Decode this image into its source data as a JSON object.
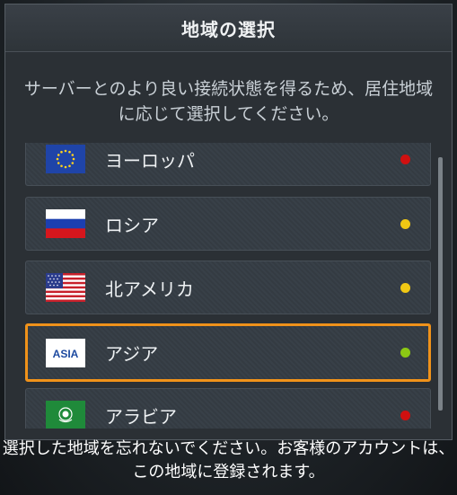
{
  "dialog": {
    "title": "地域の選択",
    "description": "サーバーとのより良い接続状態を得るため、居住地域に応じて選択してください。"
  },
  "regions": [
    {
      "label": "ヨーロッパ",
      "flag_icon": "eu-flag-icon",
      "status_color": "#d01010"
    },
    {
      "label": "ロシア",
      "flag_icon": "russia-flag-icon",
      "status_color": "#f0c814"
    },
    {
      "label": "北アメリカ",
      "flag_icon": "usa-flag-icon",
      "status_color": "#f0c814"
    },
    {
      "label": "アジア",
      "flag_icon": "asia-flag-icon",
      "flag_text": "ASIA",
      "status_color": "#8cc814",
      "selected": true
    },
    {
      "label": "アラビア",
      "flag_icon": "arab-league-flag-icon",
      "status_color": "#d01010"
    }
  ],
  "footer": {
    "note": "選択した地域を忘れないでください。お客様のアカウントは、この地域に登録されます。"
  },
  "colors": {
    "selected_border": "#f0921a",
    "status_red": "#d01010",
    "status_yellow": "#f0c814",
    "status_green": "#8cc814"
  }
}
